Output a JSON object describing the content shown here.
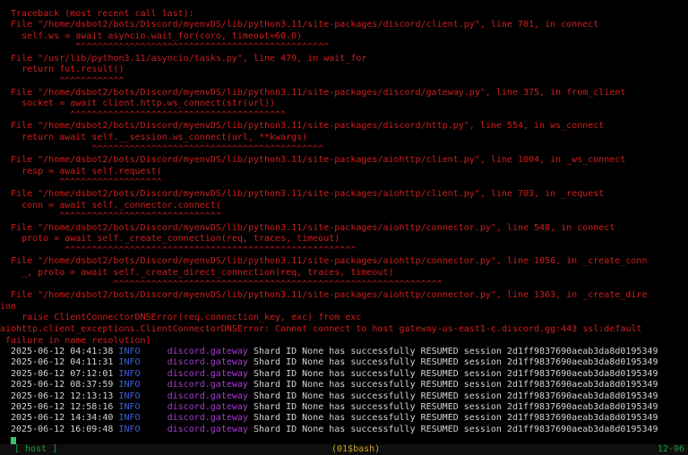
{
  "traceback": {
    "header": "Traceback (most recent call last):",
    "frames": [
      {
        "file": "  File \"/home/dsbot2/bots/Discord/myenvDS/lib/python3.11/site-packages/discord/client.py\", line 701, in connect",
        "code": "    self.ws = await asyncio.wait_for(coro, timeout=60.0)",
        "caret": "              ^^^^^^^^^^^^^^^^^^^^^^^^^^^^^^^^^^^^^^^^^^^^^^^"
      },
      {
        "file": "  File \"/usr/lib/python3.11/asyncio/tasks.py\", line 479, in wait_for",
        "code": "    return fut.result()",
        "caret": "           ^^^^^^^^^^^^"
      },
      {
        "file": "  File \"/home/dsbot2/bots/Discord/myenvDS/lib/python3.11/site-packages/discord/gateway.py\", line 375, in from_client",
        "code": "    socket = await client.http.ws_connect(str(url))",
        "caret": "             ^^^^^^^^^^^^^^^^^^^^^^^^^^^^^^^^^^^^^^^^"
      },
      {
        "file": "  File \"/home/dsbot2/bots/Discord/myenvDS/lib/python3.11/site-packages/discord/http.py\", line 554, in ws_connect",
        "code": "    return await self.__session.ws_connect(url, **kwargs)",
        "caret": "                 ^^^^^^^^^^^^^^^^^^^^^^^^^^^^^^^^^^^^^^^^^^^"
      },
      {
        "file": "  File \"/home/dsbot2/bots/Discord/myenvDS/lib/python3.11/site-packages/aiohttp/client.py\", line 1004, in _ws_connect",
        "code": "    resp = await self.request(",
        "caret": "           ^^^^^^^^^^^^^^^^^^^"
      },
      {
        "file": "  File \"/home/dsbot2/bots/Discord/myenvDS/lib/python3.11/site-packages/aiohttp/client.py\", line 703, in _request",
        "code": "    conn = await self._connector.connect(",
        "caret": "           ^^^^^^^^^^^^^^^^^^^^^^^^^^^^^^"
      },
      {
        "file": "  File \"/home/dsbot2/bots/Discord/myenvDS/lib/python3.11/site-packages/aiohttp/connector.py\", line 548, in connect",
        "code": "    proto = await self._create_connection(req, traces, timeout)",
        "caret": "            ^^^^^^^^^^^^^^^^^^^^^^^^^^^^^^^^^^^^^^^^^^^^^^^^^^^^^^"
      },
      {
        "file": "  File \"/home/dsbot2/bots/Discord/myenvDS/lib/python3.11/site-packages/aiohttp/connector.py\", line 1056, in _create_conn",
        "code": "    _, proto = await self._create_direct_connection(req, traces, timeout)",
        "caret": "                     ^^^^^^^^^^^^^^^^^^^^^^^^^^^^^^^^^^^^^^^^^^^^^^^^^^^^^^^^^^^^^"
      },
      {
        "file": "  File \"/home/dsbot2/bots/Discord/myenvDS/lib/python3.11/site-packages/aiohttp/connector.py\", line 1363, in _create_dire",
        "code": "ion",
        "caret": ""
      }
    ],
    "raise_line": "    raise ClientConnectorDNSError(req.connection_key, exc) from exc",
    "error_line_1": "aiohttp.client_exceptions.ClientConnectorDNSError: Cannot connect to host gateway-us-east1-c.discord.gg:443 ssl:default",
    "error_line_2": " failure in name resolution]"
  },
  "logs": [
    {
      "ts": "2025-06-12 04:41:38",
      "level": "INFO",
      "source": "discord.gateway",
      "msg": "Shard ID None has successfully RESUMED session 2d1ff9837690aeab3da8d0195349"
    },
    {
      "ts": "2025-06-12 04:11:31",
      "level": "INFO",
      "source": "discord.gateway",
      "msg": "Shard ID None has successfully RESUMED session 2d1ff9837690aeab3da8d0195349"
    },
    {
      "ts": "2025-06-12 07:12:01",
      "level": "INFO",
      "source": "discord.gateway",
      "msg": "Shard ID None has successfully RESUMED session 2d1ff9837690aeab3da8d0195349"
    },
    {
      "ts": "2025-06-12 08:37:59",
      "level": "INFO",
      "source": "discord.gateway",
      "msg": "Shard ID None has successfully RESUMED session 2d1ff9837690aeab3da8d0195349"
    },
    {
      "ts": "2025-06-12 12:13:13",
      "level": "INFO",
      "source": "discord.gateway",
      "msg": "Shard ID None has successfully RESUMED session 2d1ff9837690aeab3da8d0195349"
    },
    {
      "ts": "2025-06-12 12:58:16",
      "level": "INFO",
      "source": "discord.gateway",
      "msg": "Shard ID None has successfully RESUMED session 2d1ff9837690aeab3da8d0195349"
    },
    {
      "ts": "2025-06-12 14:34:40",
      "level": "INFO",
      "source": "discord.gateway",
      "msg": "Shard ID None has successfully RESUMED session 2d1ff9837690aeab3da8d0195349"
    },
    {
      "ts": "2025-06-12 16:09:48",
      "level": "INFO",
      "source": "discord.gateway",
      "msg": "Shard ID None has successfully RESUMED session 2d1ff9837690aeab3da8d0195349"
    }
  ],
  "status_bar": {
    "left": "[ host ]",
    "middle": "(01$bash)",
    "right": "12-06"
  },
  "colors": {
    "error": "#d11d1d",
    "info": "#3b5fd8",
    "source": "#a83ad4",
    "text": "#d4d4d4",
    "cursor": "#39c070",
    "status": "#1e9a3c"
  }
}
